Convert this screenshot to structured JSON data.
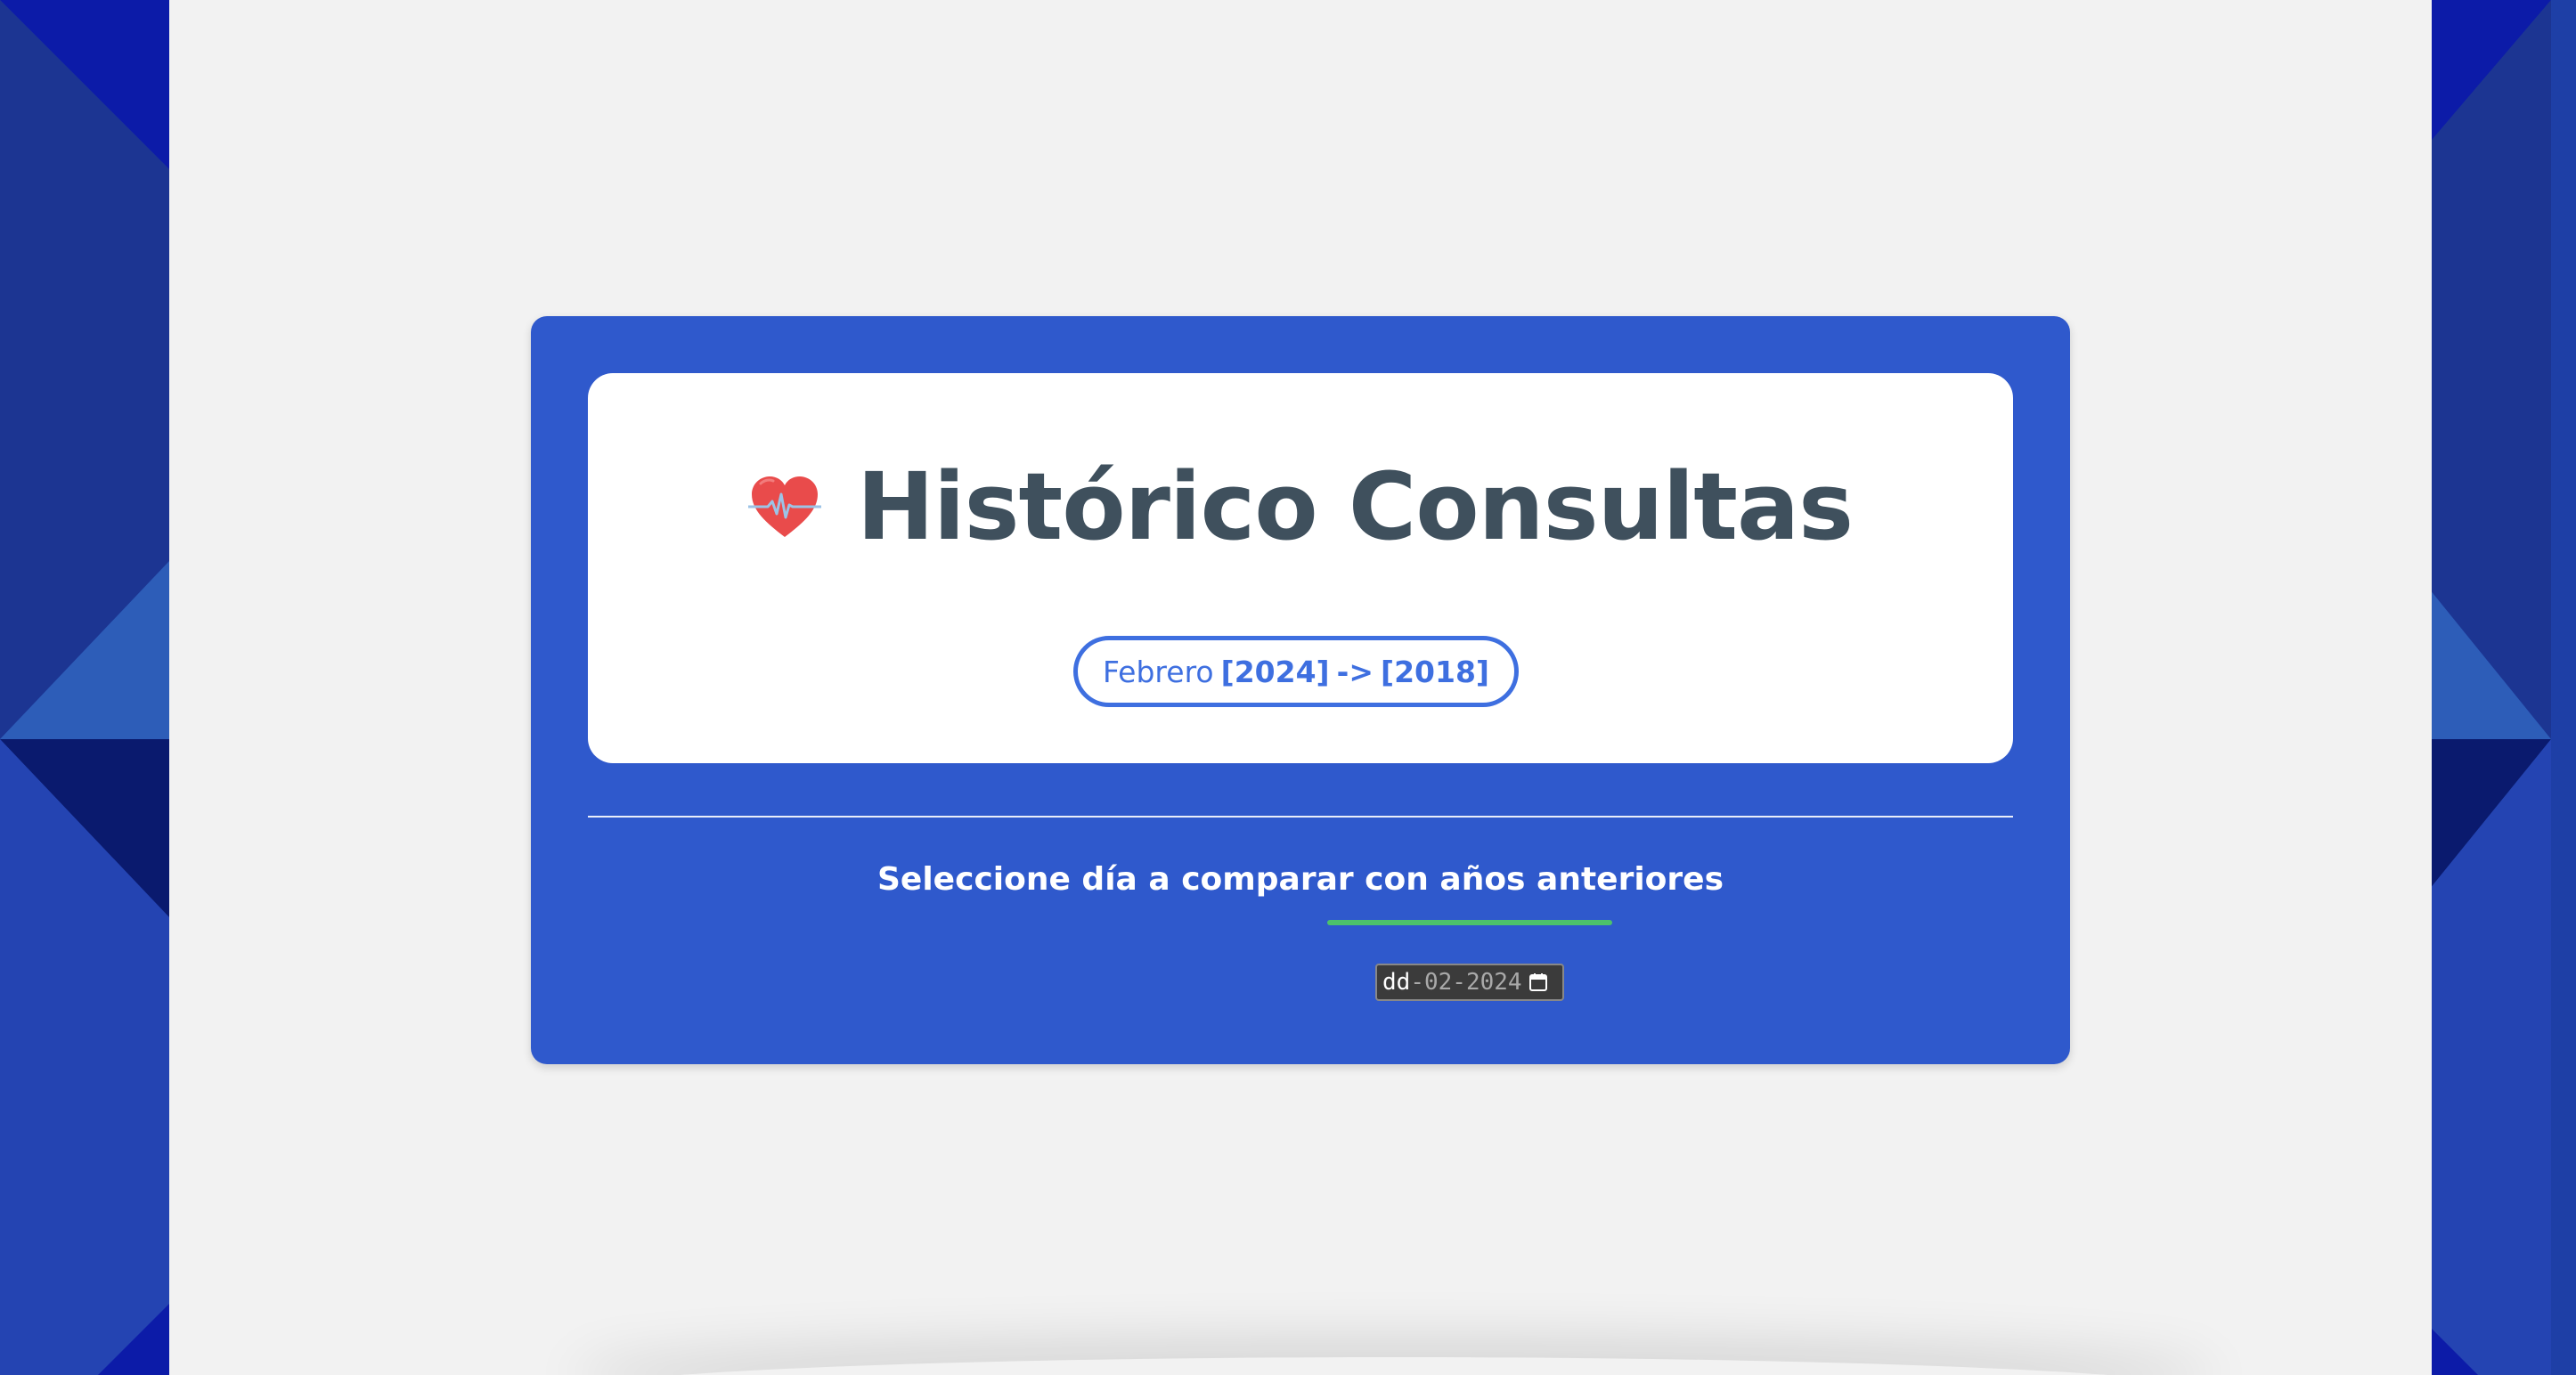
{
  "app": {
    "title": "Histórico Consultas",
    "icon": "heartbeat-icon"
  },
  "range_pill": {
    "month": "Febrero",
    "from_year": "[2024]",
    "arrow": "->",
    "to_year": "[2018]"
  },
  "selector": {
    "instruction": "Seleccione día a comparar con años anteriores",
    "date_input": {
      "day_placeholder": "dd",
      "sep1": "-",
      "month": "02",
      "sep2": "-",
      "year": "2024",
      "icon": "calendar-icon"
    }
  },
  "colors": {
    "card_blue": "#2F59CC",
    "accent_blue": "#3E6FE0",
    "title_text": "#3F505D",
    "underline_green": "#4CC26B",
    "page_bg": "#F2F2F2",
    "heart_red": "#E94B4B"
  }
}
